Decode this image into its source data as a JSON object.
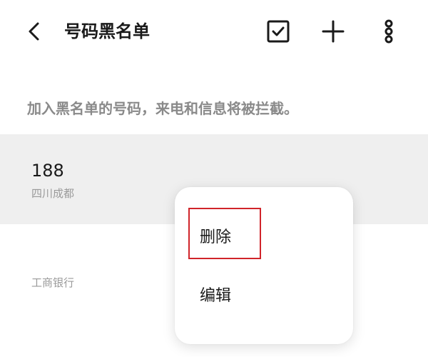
{
  "header": {
    "title": "号码黑名单",
    "icons": [
      "back-arrow-icon",
      "select-checkbox-icon",
      "add-icon",
      "more-icon"
    ]
  },
  "description": "加入黑名单的号码，来电和信息将被拦截。",
  "list": [
    {
      "number": "188",
      "location": "四川成都"
    },
    {
      "number": "",
      "location": "工商银行"
    }
  ],
  "context_menu": {
    "items": [
      {
        "label": "删除"
      },
      {
        "label": "编辑"
      }
    ]
  },
  "colors": {
    "highlight_border": "#d0242a",
    "selected_row_bg": "#efefef",
    "text_primary": "#1a1a1a",
    "text_secondary": "#8a8a8a"
  }
}
